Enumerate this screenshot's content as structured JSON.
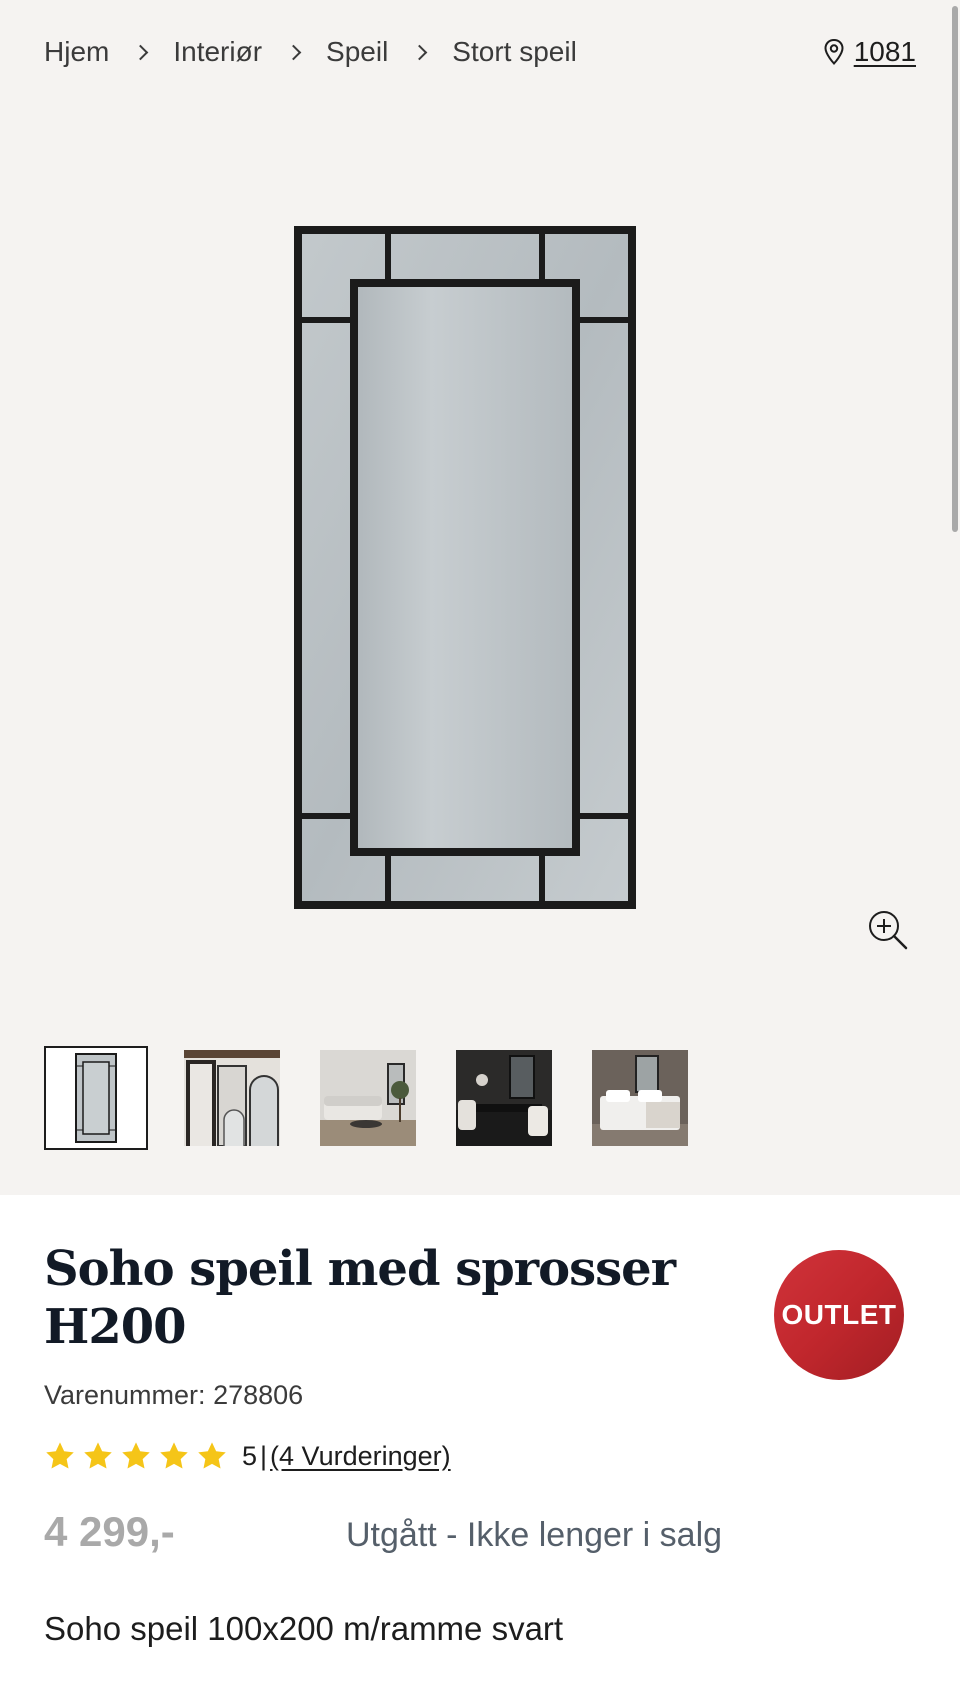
{
  "breadcrumb": {
    "items": [
      "Hjem",
      "Interiør",
      "Speil",
      "Stort speil"
    ]
  },
  "store": {
    "icon": "location-pin-icon",
    "label": "1081"
  },
  "gallery": {
    "zoom_icon": "zoom-in-icon",
    "thumbnails": [
      "product-front",
      "mirror-lifestyle",
      "living-room",
      "dining-room",
      "bedroom"
    ],
    "active_index": 0
  },
  "product": {
    "title": "Soho speil med sprosser H200",
    "sku_label": "Varenummer:",
    "sku": "278806",
    "badge": "OUTLET",
    "rating_value": "5",
    "rating_stars": 5,
    "rating_separator": "|",
    "reviews_label": "(4 Vurderinger)",
    "price": "4 299,-",
    "status": "Utgått - Ikke lenger i salg",
    "description": "Soho speil 100x200 m/ramme svart"
  },
  "colors": {
    "star": "#f5c518",
    "outlet_badge": "#c1272d",
    "gallery_bg": "#f5f3f1",
    "frame": "#1b1b1b",
    "glass": "#b8bfc3"
  }
}
